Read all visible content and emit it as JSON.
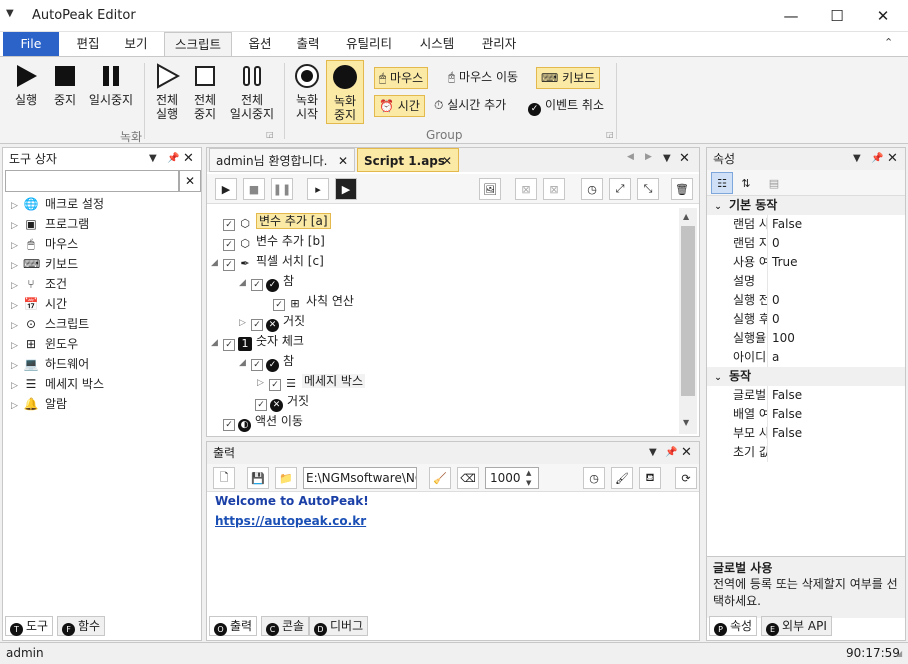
{
  "app": {
    "title": "AutoPeak Editor",
    "clock": "90:17:59",
    "status_user": "admin"
  },
  "menu": {
    "file": "File",
    "items": [
      "편집",
      "보기",
      "스크립트",
      "옵션",
      "출력",
      "유틸리티",
      "시스템",
      "관리자"
    ]
  },
  "ribbon": {
    "run": "실행",
    "stop": "중지",
    "pause": "일시중지",
    "all_run": [
      "전체",
      "실행"
    ],
    "all_stop": [
      "전체",
      "중지"
    ],
    "all_pause": [
      "전체",
      "일시중지"
    ],
    "rec_start": [
      "녹화",
      "시작"
    ],
    "rec_stop": [
      "녹화",
      "중지"
    ],
    "mouse": "마우스",
    "mouse_move": "마우스 이동",
    "keyboard": "키보드",
    "time": "시간",
    "realtime_add": "실시간 추가",
    "event_cancel": "이벤트 취소",
    "group_rec": "녹화",
    "group_group": "Group"
  },
  "toolbox": {
    "title": "도구 상자",
    "items": [
      "매크로 설정",
      "프로그램",
      "마우스",
      "키보드",
      "조건",
      "시간",
      "스크립트",
      "윈도우",
      "하드웨어",
      "메세지 박스",
      "알람"
    ],
    "tabs": [
      {
        "letter": "T",
        "label": "도구"
      },
      {
        "letter": "F",
        "label": "함수"
      }
    ]
  },
  "doc": {
    "tabs": [
      "admin님 환영합니다.",
      "Script 1.aps"
    ],
    "tree": [
      {
        "label": "변수 추가 [a]",
        "level": 0,
        "icon": "cube",
        "selected": true
      },
      {
        "label": "변수 추가 [b]",
        "level": 0,
        "icon": "cube"
      },
      {
        "label": "픽셀 서치 [c]",
        "level": 0,
        "icon": "eyedropper",
        "expander": "open"
      },
      {
        "label": "참",
        "level": 1,
        "icon": "check",
        "expander": "open"
      },
      {
        "label": "사칙 연산",
        "level": 2,
        "icon": "calc"
      },
      {
        "label": "거짓",
        "level": 1,
        "icon": "x",
        "expander": "closed"
      },
      {
        "label": "숫자 체크",
        "level": 0,
        "icon": "one",
        "expander": "open"
      },
      {
        "label": "참",
        "level": 1,
        "icon": "check",
        "expander": "open"
      },
      {
        "label": "메세지 박스",
        "level": 2,
        "icon": "msg",
        "expander": "closed",
        "boxed": true
      },
      {
        "label": "거짓",
        "level": 1,
        "icon": "x"
      },
      {
        "label": "액션 이동",
        "level": 0,
        "icon": "action"
      }
    ]
  },
  "output": {
    "title": "출력",
    "path": "E:\\NGMsoftware\\NG",
    "num": "1000",
    "line1": "Welcome to AutoPeak!",
    "line2": "https://autopeak.co.kr",
    "tabs": [
      {
        "letter": "O",
        "label": "출력"
      },
      {
        "letter": "C",
        "label": "콘솔"
      },
      {
        "letter": "D",
        "label": "디버그"
      }
    ]
  },
  "props": {
    "title": "속성",
    "rows": [
      {
        "cat": "기본 동작"
      },
      {
        "name": "랜덤 사용",
        "value": "False"
      },
      {
        "name": "랜덤 지연",
        "value": "0"
      },
      {
        "name": "사용 여부",
        "value": "True"
      },
      {
        "name": "설명",
        "value": ""
      },
      {
        "name": "실행 전 지",
        "value": "0"
      },
      {
        "name": "실행 후 지",
        "value": "0"
      },
      {
        "name": "실행율",
        "value": "100"
      },
      {
        "name": "아이디",
        "value": "a"
      },
      {
        "cat": "동작"
      },
      {
        "name": "글로벌 사",
        "value": "False"
      },
      {
        "name": "배열 여부",
        "value": "False"
      },
      {
        "name": "부모 사용",
        "value": "False"
      },
      {
        "name": "초기 값",
        "value": ""
      }
    ],
    "desc_title": "글로벌 사용",
    "desc_text": "전역에 등록 또는 삭제할지 여부를 선택하세요.",
    "tabs": [
      {
        "letter": "P",
        "label": "속성"
      },
      {
        "letter": "E",
        "label": "외부 API"
      }
    ]
  },
  "colors": {
    "accent": "#2b63c9",
    "highlight": "#fbe9a6",
    "link": "#1a4fb5"
  }
}
